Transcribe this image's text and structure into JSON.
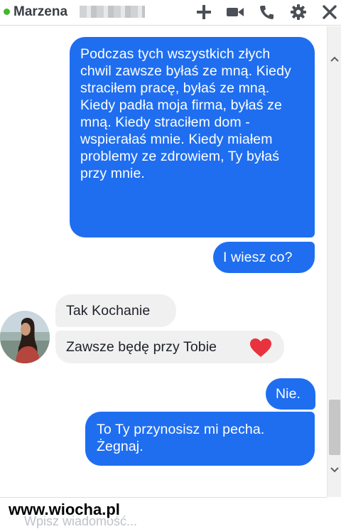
{
  "header": {
    "contact_name": "Marzena",
    "status": "online",
    "icons": [
      "add-person-icon",
      "video-call-icon",
      "phone-icon",
      "settings-gear-icon",
      "close-icon"
    ]
  },
  "messages": [
    {
      "direction": "sent",
      "text": "Podczas tych wszystkich złych chwil zawsze byłaś ze mną. Kiedy straciłem pracę, byłaś ze mną. Kiedy padła moja firma, byłaś ze mną. Kiedy straciłem dom - wspierałaś mnie. Kiedy miałem problemy ze zdrowiem, Ty byłaś przy mnie."
    },
    {
      "direction": "sent",
      "text": "I wiesz co?"
    },
    {
      "direction": "received",
      "text": "Tak Kochanie"
    },
    {
      "direction": "received",
      "text": "Zawsze będę przy Tobie",
      "emoji": "heart-icon"
    },
    {
      "direction": "sent",
      "text": "Nie."
    },
    {
      "direction": "sent",
      "text": "To Ty przynosisz mi pecha. Żegnaj."
    }
  ],
  "compose": {
    "placeholder": "Wpisz wiadomość..."
  },
  "watermark": "www.wiocha.pl",
  "colors": {
    "sent_bubble": "#1f6ef0",
    "received_bubble": "#f1f0f0",
    "online": "#42b72a",
    "header_icons": "#4b4f56"
  }
}
